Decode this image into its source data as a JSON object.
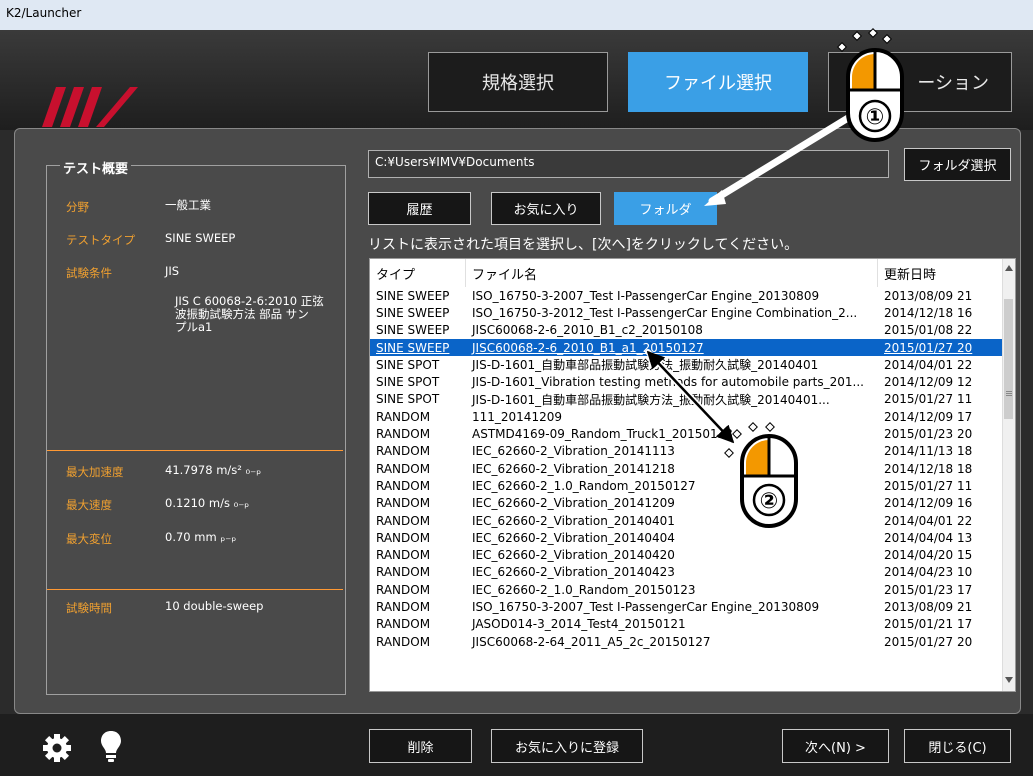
{
  "window": {
    "title": "K2/Launcher"
  },
  "topnav": {
    "standard": "規格選択",
    "file": "ファイル選択",
    "operation": "ーション"
  },
  "summary": {
    "title": "テスト概要",
    "field_label": "分野",
    "field_value": "一般工業",
    "type_label": "テストタイプ",
    "type_value": "SINE SWEEP",
    "cond_label": "試験条件",
    "cond_value": "JIS",
    "cond_line1": "JIS C 60068-2-6:2010 正弦",
    "cond_line2": "波振動試験方法 部品 サン",
    "cond_line3": "プルa1",
    "acc_label": "最大加速度",
    "acc_value": "41.7978 m/s² ₀₋ₚ",
    "vel_label": "最大速度",
    "vel_value": "0.1210 m/s ₀₋ₚ",
    "disp_label": "最大変位",
    "disp_value": "0.70 mm ₚ₋ₚ",
    "time_label": "試験時間",
    "time_value": "10 double-sweep"
  },
  "folder": {
    "path": "C:¥Users¥IMV¥Documents",
    "select_button": "フォルダ選択"
  },
  "tabs": {
    "history": "履歴",
    "favorites": "お気に入り",
    "folder": "フォルダ"
  },
  "instruction": "リストに表示された項目を選択し、[次へ]をクリックしてください。",
  "table": {
    "headers": {
      "type": "タイプ",
      "file": "ファイル名",
      "date": "更新日時"
    },
    "rows": [
      {
        "type": "SINE SWEEP",
        "file": "ISO_16750-3-2007_Test I-PassengerCar Engine_20130809",
        "date": "2013/08/09 21"
      },
      {
        "type": "SINE SWEEP",
        "file": "ISO_16750-3-2012_Test I-PassengerCar Engine Combination_2...",
        "date": "2014/12/18 16"
      },
      {
        "type": "SINE SWEEP",
        "file": "JISC60068-2-6_2010_B1_c2_20150108",
        "date": "2015/01/08 22"
      },
      {
        "type": "SINE SWEEP",
        "file": "JISC60068-2-6_2010_B1_a1_20150127",
        "date": "2015/01/27 20"
      },
      {
        "type": "SINE SPOT",
        "file": "JIS-D-1601_自動車部品振動試験方法_振動耐久試験_20140401",
        "date": "2014/04/01 22"
      },
      {
        "type": "SINE SPOT",
        "file": "JIS-D-1601_Vibration testing methods for automobile parts_201...",
        "date": "2014/12/09 12"
      },
      {
        "type": "SINE SPOT",
        "file": "JIS-D-1601_自動車部品振動試験方法_振動耐久試験_20140401...",
        "date": "2015/01/27 11"
      },
      {
        "type": "RANDOM",
        "file": "111_20141209",
        "date": "2014/12/09 17"
      },
      {
        "type": "RANDOM",
        "file": "ASTMD4169-09_Random_Truck1_20150123",
        "date": "2015/01/23 20"
      },
      {
        "type": "RANDOM",
        "file": "IEC_62660-2_Vibration_20141113",
        "date": "2014/11/13 18"
      },
      {
        "type": "RANDOM",
        "file": "IEC_62660-2_Vibration_20141218",
        "date": "2014/12/18 18"
      },
      {
        "type": "RANDOM",
        "file": "IEC_62660-2_1.0_Random_20150127",
        "date": "2015/01/27 11"
      },
      {
        "type": "RANDOM",
        "file": "IEC_62660-2_Vibration_20141209",
        "date": "2014/12/09 16"
      },
      {
        "type": "RANDOM",
        "file": "IEC_62660-2_Vibration_20140401",
        "date": "2014/04/01 22"
      },
      {
        "type": "RANDOM",
        "file": "IEC_62660-2_Vibration_20140404",
        "date": "2014/04/04 13"
      },
      {
        "type": "RANDOM",
        "file": "IEC_62660-2_Vibration_20140420",
        "date": "2014/04/20 15"
      },
      {
        "type": "RANDOM",
        "file": "IEC_62660-2_Vibration_20140423",
        "date": "2014/04/23 10"
      },
      {
        "type": "RANDOM",
        "file": "IEC_62660-2_1.0_Random_20150123",
        "date": "2015/01/23 17"
      },
      {
        "type": "RANDOM",
        "file": "ISO_16750-3-2007_Test I-PassengerCar Engine_20130809",
        "date": "2013/08/09 21"
      },
      {
        "type": "RANDOM",
        "file": "JASOD014-3_2014_Test4_20150121",
        "date": "2015/01/21 17"
      },
      {
        "type": "RANDOM",
        "file": "JISC60068-2-64_2011_A5_2c_20150127",
        "date": "2015/01/27 20"
      }
    ],
    "selected_index": 3
  },
  "bottom": {
    "delete": "削除",
    "add_favorite": "お気に入りに登録",
    "next": "次へ(N) >",
    "close": "閉じる(C)"
  },
  "callouts": {
    "step1": "①",
    "step2": "②"
  }
}
